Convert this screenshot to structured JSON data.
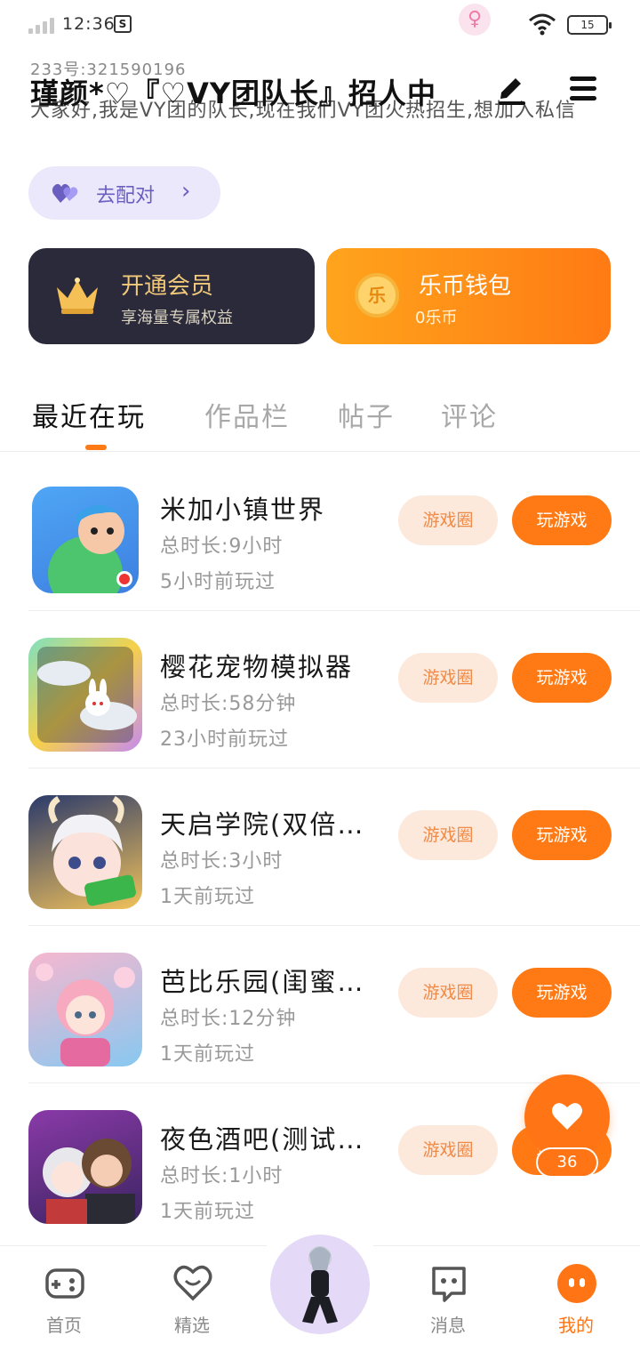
{
  "status_bar": {
    "time": "12:36",
    "sim_icon": "S",
    "battery": "15"
  },
  "profile": {
    "uid": "233号:321590196",
    "nickname": "瑾颜*♡『♡VY团队长』招人中",
    "bio": "大家好,我是VY团的队长,现在我们VY团火热招生,想加入私信",
    "match_button": "去配对",
    "gender_icon": "female-icon"
  },
  "cards": {
    "vip": {
      "title": "开通会员",
      "subtitle": "享海量专属权益"
    },
    "wallet": {
      "coin_char": "乐",
      "title": "乐币钱包",
      "subtitle": "0乐币"
    }
  },
  "tabs": [
    "最近在玩",
    "作品栏",
    "帖子",
    "评论"
  ],
  "game_circle_label": "游戏圈",
  "play_label": "玩游戏",
  "games": [
    {
      "name": "米加小镇世界",
      "total_time": "总时长:9小时",
      "last_played": "5小时前玩过"
    },
    {
      "name": "樱花宠物模拟器",
      "total_time": "总时长:58分钟",
      "last_played": "23小时前玩过"
    },
    {
      "name": "天启学院(双倍…",
      "total_time": "总时长:3小时",
      "last_played": "1天前玩过"
    },
    {
      "name": "芭比乐园(闺蜜…",
      "total_time": "总时长:12分钟",
      "last_played": "1天前玩过"
    },
    {
      "name": "夜色酒吧(测试…",
      "total_time": "总时长:1小时",
      "last_played": "1天前玩过"
    }
  ],
  "float_like": {
    "count": "36"
  },
  "bottom_nav": [
    {
      "label": "首页",
      "icon": "gamepad-icon"
    },
    {
      "label": "精选",
      "icon": "heart-chat-icon"
    },
    {
      "label": "消息",
      "icon": "message-icon"
    },
    {
      "label": "我的",
      "icon": "profile-face-icon"
    }
  ],
  "colors": {
    "accent": "#ff7a14",
    "match_purple": "#6a5fc1",
    "vip_gold": "#f2c97a"
  }
}
